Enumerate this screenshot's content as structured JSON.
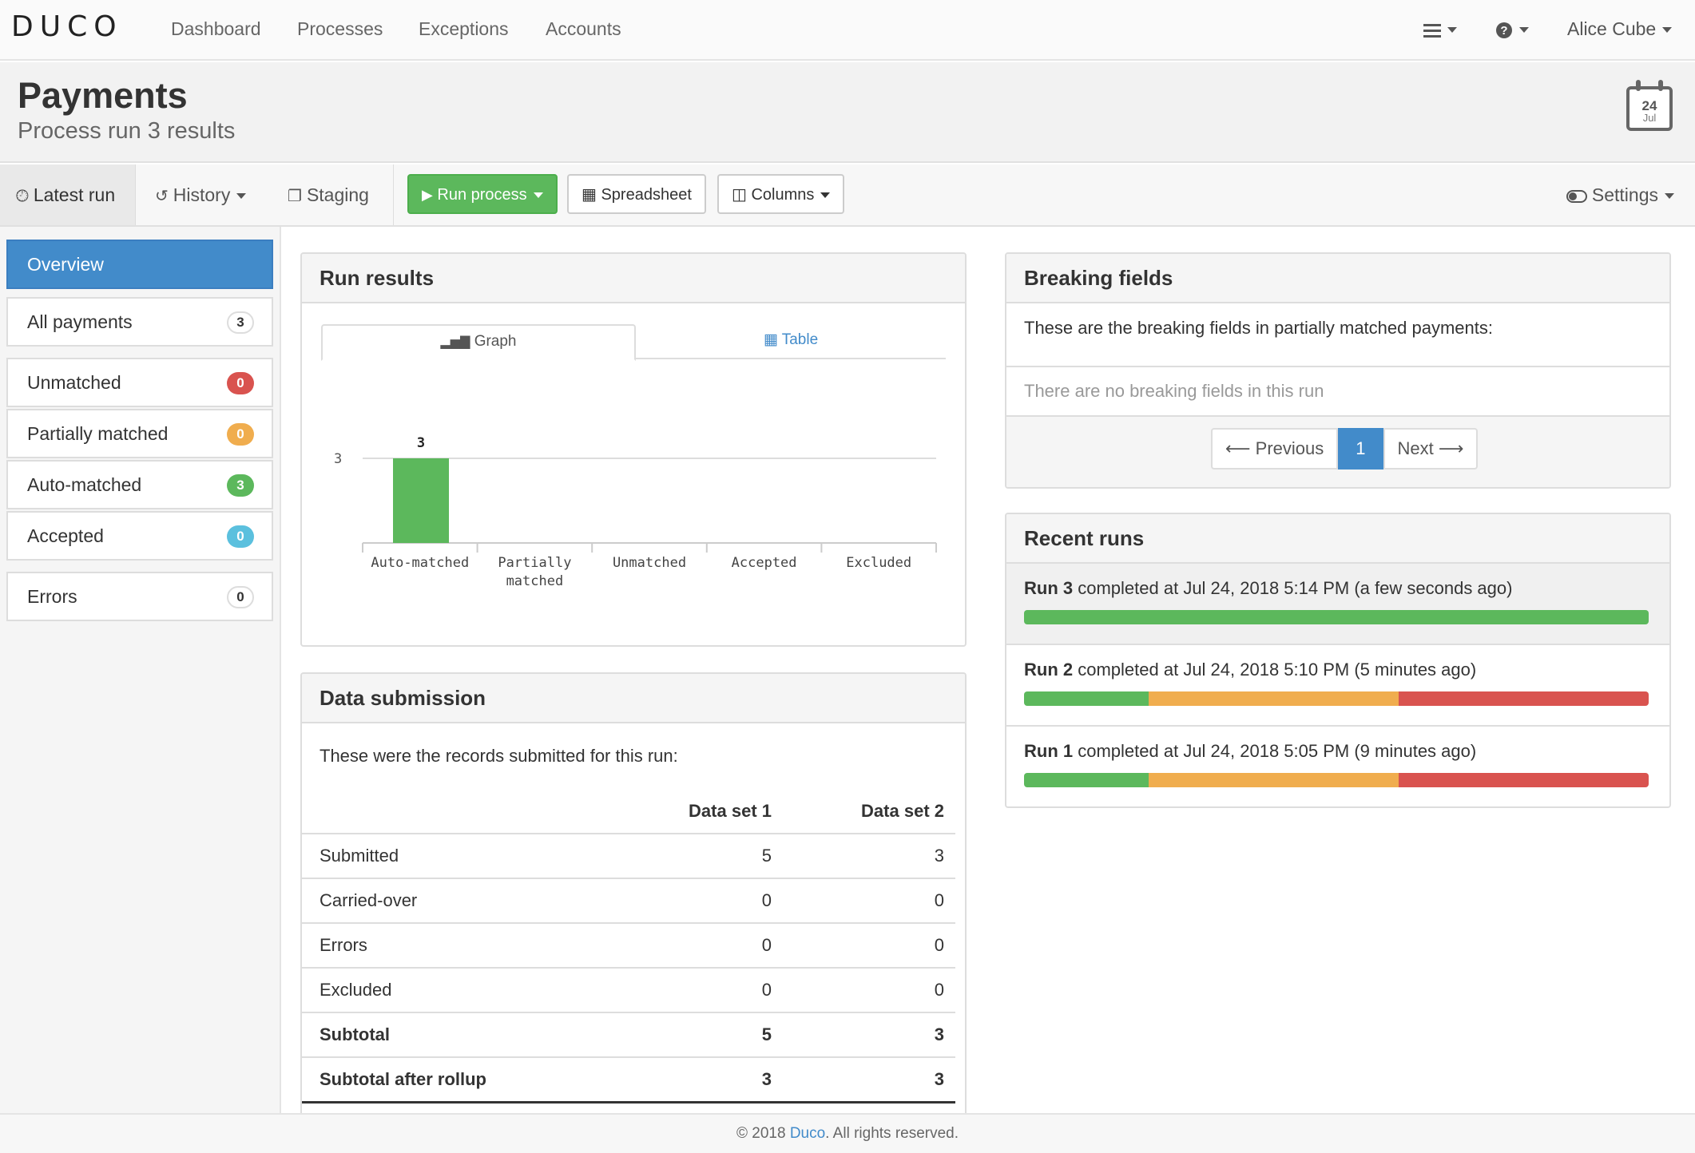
{
  "nav": {
    "logo": "DUCO",
    "links": [
      "Dashboard",
      "Processes",
      "Exceptions",
      "Accounts"
    ],
    "menu_icon": "hamburger-icon",
    "help_icon": "question-circle-icon",
    "user": "Alice Cube"
  },
  "header": {
    "title": "Payments",
    "subtitle": "Process run 3 results",
    "calendar": {
      "day": "24",
      "month": "Jul"
    }
  },
  "toolbar": {
    "latest_run": "Latest run",
    "history": "History",
    "staging": "Staging",
    "run_process": "Run process",
    "spreadsheet": "Spreadsheet",
    "columns": "Columns",
    "settings": "Settings"
  },
  "sidebar": {
    "overview": "Overview",
    "items": [
      {
        "label": "All payments",
        "count": "3",
        "color": "light"
      },
      {
        "label": "Unmatched",
        "count": "0",
        "color": "red"
      },
      {
        "label": "Partially matched",
        "count": "0",
        "color": "orange"
      },
      {
        "label": "Auto-matched",
        "count": "3",
        "color": "green"
      },
      {
        "label": "Accepted",
        "count": "0",
        "color": "blue"
      },
      {
        "label": "Errors",
        "count": "0",
        "color": "light"
      }
    ]
  },
  "run_results": {
    "title": "Run results",
    "tab_graph": "Graph",
    "tab_table": "Table"
  },
  "chart_data": {
    "type": "bar",
    "categories": [
      "Auto-matched",
      "Partially matched",
      "Unmatched",
      "Accepted",
      "Excluded"
    ],
    "values": [
      3,
      0,
      0,
      0,
      0
    ],
    "data_labels": [
      "3",
      "",
      "",
      "",
      ""
    ],
    "ytick": "3",
    "bar_color": "#5cb85c",
    "ylim": [
      0,
      3
    ]
  },
  "data_submission": {
    "title": "Data submission",
    "intro": "These were the records submitted for this run:",
    "columns": [
      "",
      "Data set 1",
      "Data set 2"
    ],
    "rows": [
      {
        "label": "Submitted",
        "ds1": "5",
        "ds2": "3"
      },
      {
        "label": "Carried-over",
        "ds1": "0",
        "ds2": "0"
      },
      {
        "label": "Errors",
        "ds1": "0",
        "ds2": "0"
      },
      {
        "label": "Excluded",
        "ds1": "0",
        "ds2": "0"
      },
      {
        "label": "Subtotal",
        "ds1": "5",
        "ds2": "3"
      },
      {
        "label": "Subtotal after rollup",
        "ds1": "3",
        "ds2": "3"
      }
    ]
  },
  "breaking_fields": {
    "title": "Breaking fields",
    "intro": "These are the breaking fields in partially matched payments:",
    "empty": "There are no breaking fields in this run",
    "pager": {
      "prev": "Previous",
      "current": "1",
      "next": "Next"
    }
  },
  "recent_runs": {
    "title": "Recent runs",
    "runs": [
      {
        "name": "Run 3",
        "text": "completed at Jul 24, 2018 5:14 PM (a few seconds ago)",
        "green": 1.0,
        "orange": 0.0,
        "red": 0.0
      },
      {
        "name": "Run 2",
        "text": "completed at Jul 24, 2018 5:10 PM (5 minutes ago)",
        "green": 0.2,
        "orange": 0.4,
        "red": 0.4
      },
      {
        "name": "Run 1",
        "text": "completed at Jul 24, 2018 5:05 PM (9 minutes ago)",
        "green": 0.2,
        "orange": 0.4,
        "red": 0.4
      }
    ]
  },
  "footer": {
    "prefix": "© 2018 ",
    "link": "Duco",
    "suffix": ". All rights reserved."
  }
}
